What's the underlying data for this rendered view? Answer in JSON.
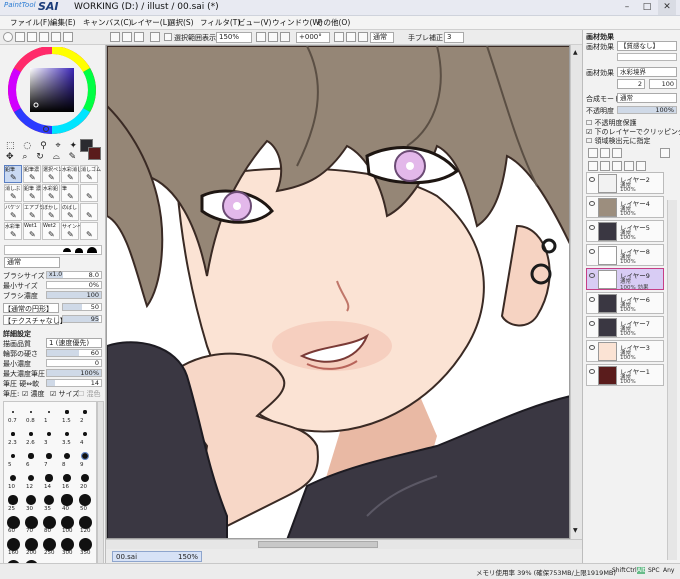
{
  "window": {
    "logo_small": "PaintTool",
    "logo_big": "SAI",
    "title": "WORKING (D:) / illust / 00.sai (*)",
    "controls": [
      "–",
      "□",
      "✕"
    ]
  },
  "menu": [
    "ファイル(F)",
    "編集(E)",
    "キャンバス(C)",
    "レイヤー(L)",
    "選択(S)",
    "フィルタ(T)",
    "ビュー(V)",
    "ウィンドウ(W)",
    "その他(O)"
  ],
  "toolbar": {
    "selection_label": "選択範囲表示",
    "zoom": "150%",
    "rotation": "+000°",
    "blend": "通常",
    "stabilizer_label": "手ブレ補正",
    "stabilizer_value": "3"
  },
  "left": {
    "tools_row1": [
      "鉛筆",
      "鉛筆濃",
      "選択ペン",
      "水彩消し",
      "消しゴム"
    ],
    "tools_row2": [
      "消しぶ",
      "鉛筆 濃",
      "水彩鉛",
      "筆",
      ""
    ],
    "tools_row3": [
      "バケツ",
      "エアブラシ",
      "ぼかし",
      "のばし",
      ""
    ],
    "tools_row4": [
      "水彩筆",
      "Wet1",
      "Wet2",
      "サインペ",
      ""
    ],
    "blend_mode": "通常",
    "brush_size_label": "ブラシサイズ",
    "brush_size_mult": "x1.0",
    "brush_size_value": "8.0",
    "min_size_label": "最小サイズ",
    "min_size_value": "0%",
    "density_label": "ブラシ濃度",
    "density_value": "100",
    "shape_label": "【通常の円形】",
    "shape_value": "50",
    "texture_label": "【テクスチャなし】",
    "texture_value": "95",
    "detail_label": "詳細設定",
    "quality_label": "描画品質",
    "quality_value": "1 (速度優先)",
    "edge_label": "輪郭の硬さ",
    "edge_value": "60",
    "min_density_label": "最小濃度",
    "min_density_value": "0",
    "max_pressure_label": "最大濃度筆圧",
    "max_pressure_value": "100%",
    "pressure_label": "筆圧 硬⇔軟",
    "pressure_value": "14",
    "pressure_checks": "筆圧:",
    "check_density": "濃度",
    "check_size": "サイズ",
    "check_blend": "混色",
    "brush_sizes": [
      "0.7",
      "0.8",
      "1",
      "1.5",
      "2",
      "2.3",
      "2.6",
      "3",
      "3.5",
      "4",
      "5",
      "6",
      "7",
      "8",
      "9",
      "10",
      "12",
      "14",
      "16",
      "20",
      "25",
      "30",
      "35",
      "40",
      "50",
      "60",
      "70",
      "80",
      "100",
      "120",
      "160",
      "200",
      "250",
      "300",
      "350",
      "400",
      "500"
    ]
  },
  "right": {
    "paper_texture_label": "画材効果",
    "paper_texture_value": "【質感なし】",
    "watercolor_label": "画材効果",
    "watercolor_value": "水彩境界",
    "watercolor_num1": "2",
    "watercolor_num2": "100",
    "blend_mode_label": "合成モード",
    "blend_mode_value": "通常",
    "opacity_label": "不透明度",
    "opacity_value": "100%",
    "preserve_opacity": "不透明度保護",
    "clipping": "下のレイヤーでクリッピング",
    "selection_source": "領域検出元に指定",
    "layers": [
      {
        "name": "レイヤー2",
        "mode": "通常",
        "opacity": "100%"
      },
      {
        "name": "レイヤー4",
        "mode": "通常",
        "opacity": "100%"
      },
      {
        "name": "レイヤー5",
        "mode": "通常",
        "opacity": "100%"
      },
      {
        "name": "レイヤー8",
        "mode": "通常",
        "opacity": "100%"
      },
      {
        "name": "レイヤー9",
        "mode": "通常",
        "opacity": "100% 効果"
      },
      {
        "name": "レイヤー6",
        "mode": "通常",
        "opacity": "100%"
      },
      {
        "name": "レイヤー7",
        "mode": "通常",
        "opacity": "100%"
      },
      {
        "name": "レイヤー3",
        "mode": "通常",
        "opacity": "100%"
      },
      {
        "name": "レイヤー1",
        "mode": "通常",
        "opacity": "100%"
      }
    ]
  },
  "filetab": {
    "name": "00.sai",
    "zoom": "150%"
  },
  "status": {
    "memory": "メモリ使用率 39% (確保753MB/上限1919MB)",
    "keys": [
      "Shift",
      "Ctrl",
      "Alt",
      "SPC",
      "Any"
    ]
  },
  "colors": {
    "fg": "#2b2b30",
    "bg": "#5a1c1c",
    "accent": "#c63f86"
  }
}
